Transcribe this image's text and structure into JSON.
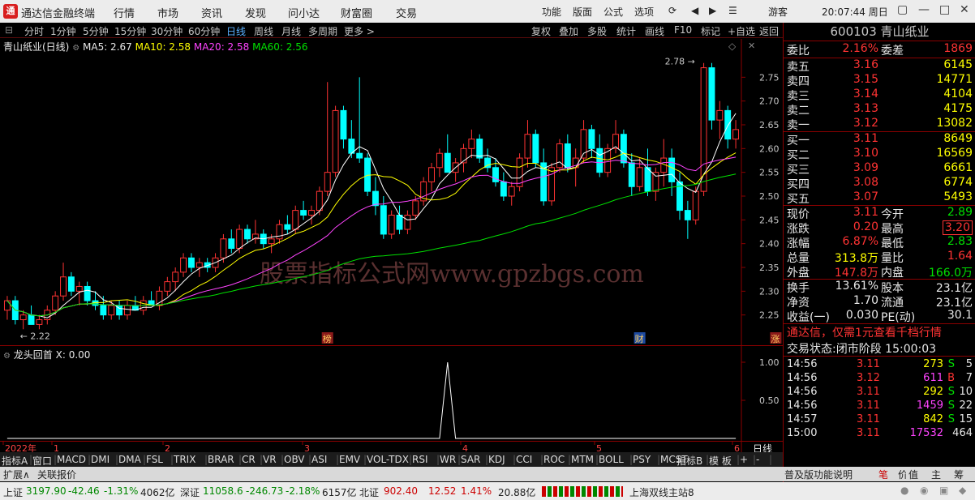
{
  "titlebar": {
    "logo": "通",
    "app_name": "通达信金融终端",
    "menus": [
      "行情",
      "市场",
      "资讯",
      "发现",
      "问小达",
      "财富圈",
      "交易"
    ],
    "tools": [
      "功能",
      "版面",
      "公式",
      "选项"
    ],
    "user": "游客",
    "clock": "20:07:44 周日"
  },
  "toolbar": {
    "periods": [
      "分时",
      "1分钟",
      "5分钟",
      "15分钟",
      "30分钟",
      "60分钟",
      "日线",
      "周线",
      "月线",
      "多周期",
      "更多 >"
    ],
    "active_period": "日线",
    "right_tools": [
      "复权",
      "叠加",
      "多股",
      "统计",
      "画线",
      "F10",
      "标记",
      "+自选",
      "返回"
    ]
  },
  "chart_info": {
    "name": "青山纸业(日线)",
    "ma5": "MA5: 2.67",
    "ma10": "MA10: 2.58",
    "ma20": "MA20: 2.58",
    "ma60": "MA60: 2.56",
    "high_label": "2.78",
    "low_label": "2.22",
    "watermark": "股票指标公式网www.gpzbgs.com",
    "markers": [
      "榜",
      "财",
      "涨"
    ],
    "colors": {
      "ma5": "#ffffff",
      "ma10": "#ffff00",
      "ma20": "#ff44ff",
      "ma60": "#00e000",
      "up": "#ff3333",
      "down": "#00ffff"
    }
  },
  "chart_data": {
    "type": "candlestick",
    "y_ticks": [
      "2.75",
      "2.70",
      "2.65",
      "2.60",
      "2.55",
      "2.50",
      "2.45",
      "2.40",
      "2.35",
      "2.30",
      "2.25"
    ],
    "ylim": [
      2.2,
      2.8
    ],
    "x_ticks": [
      "2022年",
      "1",
      "2",
      "3",
      "4",
      "5",
      "6"
    ],
    "candles": [
      [
        2.26,
        2.29,
        2.24,
        2.28
      ],
      [
        2.28,
        2.29,
        2.23,
        2.24
      ],
      [
        2.24,
        2.26,
        2.22,
        2.25
      ],
      [
        2.25,
        2.27,
        2.23,
        2.23
      ],
      [
        2.23,
        2.25,
        2.22,
        2.24
      ],
      [
        2.24,
        2.27,
        2.23,
        2.26
      ],
      [
        2.26,
        2.3,
        2.25,
        2.29
      ],
      [
        2.29,
        2.36,
        2.28,
        2.33
      ],
      [
        2.33,
        2.34,
        2.29,
        2.3
      ],
      [
        2.3,
        2.32,
        2.27,
        2.31
      ],
      [
        2.31,
        2.32,
        2.27,
        2.28
      ],
      [
        2.28,
        2.3,
        2.26,
        2.27
      ],
      [
        2.27,
        2.29,
        2.24,
        2.25
      ],
      [
        2.25,
        2.28,
        2.24,
        2.27
      ],
      [
        2.27,
        2.28,
        2.24,
        2.25
      ],
      [
        2.25,
        2.28,
        2.24,
        2.27
      ],
      [
        2.27,
        2.29,
        2.26,
        2.26
      ],
      [
        2.26,
        2.29,
        2.25,
        2.28
      ],
      [
        2.28,
        2.3,
        2.27,
        2.27
      ],
      [
        2.27,
        2.31,
        2.26,
        2.3
      ],
      [
        2.3,
        2.33,
        2.29,
        2.32
      ],
      [
        2.32,
        2.35,
        2.3,
        2.34
      ],
      [
        2.34,
        2.38,
        2.33,
        2.37
      ],
      [
        2.37,
        2.38,
        2.34,
        2.35
      ],
      [
        2.35,
        2.37,
        2.33,
        2.36
      ],
      [
        2.36,
        2.37,
        2.34,
        2.35
      ],
      [
        2.35,
        2.38,
        2.34,
        2.37
      ],
      [
        2.37,
        2.42,
        2.36,
        2.41
      ],
      [
        2.41,
        2.43,
        2.38,
        2.39
      ],
      [
        2.39,
        2.44,
        2.38,
        2.43
      ],
      [
        2.43,
        2.44,
        2.4,
        2.41
      ],
      [
        2.41,
        2.45,
        2.4,
        2.42
      ],
      [
        2.42,
        2.43,
        2.39,
        2.4
      ],
      [
        2.4,
        2.42,
        2.38,
        2.41
      ],
      [
        2.41,
        2.45,
        2.4,
        2.44
      ],
      [
        2.44,
        2.46,
        2.42,
        2.43
      ],
      [
        2.43,
        2.48,
        2.42,
        2.47
      ],
      [
        2.47,
        2.49,
        2.45,
        2.46
      ],
      [
        2.46,
        2.48,
        2.44,
        2.47
      ],
      [
        2.47,
        2.52,
        2.46,
        2.51
      ],
      [
        2.51,
        2.74,
        2.5,
        2.55
      ],
      [
        2.55,
        2.69,
        2.54,
        2.68
      ],
      [
        2.68,
        2.69,
        2.6,
        2.62
      ],
      [
        2.62,
        2.66,
        2.58,
        2.59
      ],
      [
        2.59,
        2.75,
        2.57,
        2.58
      ],
      [
        2.58,
        2.59,
        2.5,
        2.51
      ],
      [
        2.51,
        2.54,
        2.46,
        2.48
      ],
      [
        2.48,
        2.5,
        2.41,
        2.42
      ],
      [
        2.42,
        2.47,
        2.41,
        2.46
      ],
      [
        2.46,
        2.48,
        2.42,
        2.43
      ],
      [
        2.43,
        2.47,
        2.42,
        2.46
      ],
      [
        2.46,
        2.5,
        2.45,
        2.49
      ],
      [
        2.49,
        2.54,
        2.48,
        2.53
      ],
      [
        2.53,
        2.57,
        2.51,
        2.56
      ],
      [
        2.56,
        2.6,
        2.54,
        2.59
      ],
      [
        2.59,
        2.63,
        2.57,
        2.55
      ],
      [
        2.55,
        2.58,
        2.53,
        2.57
      ],
      [
        2.57,
        2.61,
        2.55,
        2.6
      ],
      [
        2.6,
        2.64,
        2.58,
        2.62
      ],
      [
        2.62,
        2.63,
        2.57,
        2.58
      ],
      [
        2.58,
        2.6,
        2.55,
        2.56
      ],
      [
        2.56,
        2.58,
        2.52,
        2.53
      ],
      [
        2.53,
        2.55,
        2.49,
        2.5
      ],
      [
        2.5,
        2.53,
        2.48,
        2.52
      ],
      [
        2.52,
        2.59,
        2.51,
        2.58
      ],
      [
        2.58,
        2.66,
        2.56,
        2.63
      ],
      [
        2.63,
        2.64,
        2.56,
        2.57
      ],
      [
        2.57,
        2.6,
        2.48,
        2.49
      ],
      [
        2.49,
        2.57,
        2.48,
        2.56
      ],
      [
        2.56,
        2.62,
        2.55,
        2.61
      ],
      [
        2.61,
        2.63,
        2.55,
        2.56
      ],
      [
        2.56,
        2.6,
        2.52,
        2.58
      ],
      [
        2.58,
        2.66,
        2.57,
        2.64
      ],
      [
        2.64,
        2.65,
        2.58,
        2.6
      ],
      [
        2.6,
        2.63,
        2.54,
        2.55
      ],
      [
        2.55,
        2.61,
        2.54,
        2.6
      ],
      [
        2.6,
        2.66,
        2.59,
        2.63
      ],
      [
        2.63,
        2.64,
        2.56,
        2.57
      ],
      [
        2.57,
        2.59,
        2.5,
        2.52
      ],
      [
        2.52,
        2.58,
        2.51,
        2.56
      ],
      [
        2.56,
        2.6,
        2.5,
        2.51
      ],
      [
        2.51,
        2.56,
        2.49,
        2.55
      ],
      [
        2.55,
        2.62,
        2.52,
        2.58
      ],
      [
        2.58,
        2.6,
        2.5,
        2.53
      ],
      [
        2.53,
        2.55,
        2.45,
        2.47
      ],
      [
        2.47,
        2.49,
        2.41,
        2.45
      ],
      [
        2.45,
        2.52,
        2.44,
        2.51
      ],
      [
        2.51,
        2.78,
        2.5,
        2.77
      ],
      [
        2.77,
        2.78,
        2.64,
        2.66
      ],
      [
        2.66,
        2.7,
        2.62,
        2.68
      ],
      [
        2.68,
        2.69,
        2.6,
        2.62
      ],
      [
        2.62,
        2.66,
        2.6,
        2.64
      ]
    ]
  },
  "indicator": {
    "name": "龙头回首",
    "value": "X: 0.00",
    "y_ticks": [
      "1.00",
      "0.50"
    ],
    "signal_index": 55
  },
  "period_label": "日线",
  "indicator_tabs": [
    "指标A",
    "窗口",
    "MACD",
    "DMI",
    "DMA",
    "FSL",
    "TRIX",
    "BRAR",
    "CR",
    "VR",
    "OBV",
    "ASI",
    "EMV",
    "VOL-TDX",
    "RSI",
    "WR",
    "SAR",
    "KDJ",
    "CCI",
    "ROC",
    "MTM",
    "BOLL",
    "PSY",
    "MCST",
    "指标B",
    "模 板",
    "+",
    "-"
  ],
  "extbar": {
    "left": [
      "扩展∧",
      "关联报价"
    ],
    "right": [
      "普及版功能说明",
      "笔",
      "价",
      "细",
      "势",
      "联",
      "值",
      "主",
      "筹"
    ]
  },
  "quote": {
    "code_name": "600103 青山纸业",
    "weibi": {
      "label": "委比",
      "value": "2.16%",
      "label2": "委差",
      "value2": "1869"
    },
    "asks": [
      {
        "label": "卖五",
        "price": "3.16",
        "vol": "6145"
      },
      {
        "label": "卖四",
        "price": "3.15",
        "vol": "14771"
      },
      {
        "label": "卖三",
        "price": "3.14",
        "vol": "4104"
      },
      {
        "label": "卖二",
        "price": "3.13",
        "vol": "4175"
      },
      {
        "label": "卖一",
        "price": "3.12",
        "vol": "13082"
      }
    ],
    "bids": [
      {
        "label": "买一",
        "price": "3.11",
        "vol": "8649"
      },
      {
        "label": "买二",
        "price": "3.10",
        "vol": "16569"
      },
      {
        "label": "买三",
        "price": "3.09",
        "vol": "6661"
      },
      {
        "label": "买四",
        "price": "3.08",
        "vol": "6774"
      },
      {
        "label": "买五",
        "price": "3.07",
        "vol": "5493"
      }
    ],
    "stats1": [
      {
        "l1": "现价",
        "v1": "3.11",
        "l2": "今开",
        "v2": "2.89"
      },
      {
        "l1": "涨跌",
        "v1": "0.20",
        "l2": "最高",
        "v2": "3.20"
      },
      {
        "l1": "涨幅",
        "v1": "6.87%",
        "l2": "最低",
        "v2": "2.83"
      },
      {
        "l1": "总量",
        "v1": "313.8万",
        "l2": "量比",
        "v2": "1.64"
      },
      {
        "l1": "外盘",
        "v1": "147.8万",
        "l2": "内盘",
        "v2": "166.0万"
      }
    ],
    "stats2": [
      {
        "l1": "换手",
        "v1": "13.61%",
        "l2": "股本",
        "v2": "23.1亿"
      },
      {
        "l1": "净资",
        "v1": "1.70",
        "l2": "流通",
        "v2": "23.1亿"
      },
      {
        "l1": "收益(一)",
        "v1": "0.030",
        "l2": "PE(动)",
        "v2": "30.1"
      }
    ],
    "promo": "通达信，仅需1元查看千档行情",
    "trade_state": "交易状态:闭市阶段 15:00:03",
    "ticks": [
      {
        "time": "14:56",
        "price": "3.11",
        "vol": "273",
        "bs": "S",
        "n": "5"
      },
      {
        "time": "14:56",
        "price": "3.12",
        "vol": "611",
        "bs": "B",
        "n": "7"
      },
      {
        "time": "14:56",
        "price": "3.11",
        "vol": "292",
        "bs": "S",
        "n": "10"
      },
      {
        "time": "14:56",
        "price": "3.11",
        "vol": "1459",
        "bs": "S",
        "n": "22"
      },
      {
        "time": "14:57",
        "price": "3.11",
        "vol": "842",
        "bs": "S",
        "n": "15"
      },
      {
        "time": "15:00",
        "price": "3.11",
        "vol": "17532",
        "bs": "",
        "n": "464"
      }
    ]
  },
  "statusbar": {
    "sh": {
      "name": "上证",
      "value": "3197.90",
      "chg": "-42.46",
      "pct": "-1.31%",
      "amt": "4062亿"
    },
    "sz": {
      "name": "深证",
      "value": "11058.6",
      "chg": "-246.73",
      "pct": "-2.18%",
      "amt": "6157亿"
    },
    "bz": {
      "name": "北证",
      "value": "902.40",
      "chg": "12.52",
      "pct": "1.41%",
      "amt": "20.88亿"
    },
    "server": "上海双线主站8"
  }
}
